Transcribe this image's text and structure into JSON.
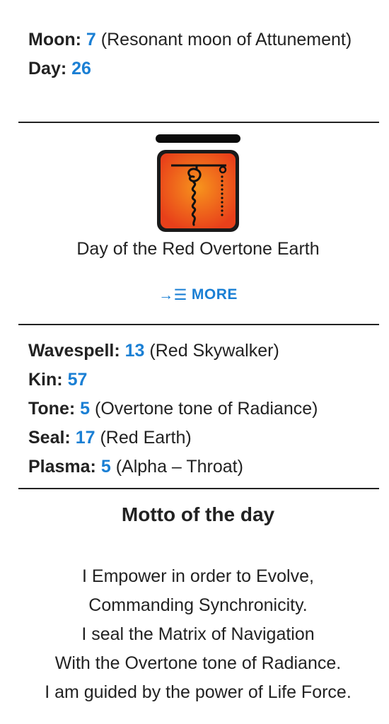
{
  "calendar": {
    "moon_label": "Moon:",
    "moon_value": "7",
    "moon_desc": "(Resonant moon of Attunement)",
    "day_label": "Day:",
    "day_value": "26"
  },
  "glyph": {
    "icon": "red-earth-seal-icon",
    "day_name": "Day of the Red Overtone Earth"
  },
  "more_button": {
    "icon": "arrow-list-icon",
    "icon_glyph": "→☰",
    "label": "MORE"
  },
  "details": {
    "wavespell_label": "Wavespell:",
    "wavespell_value": "13",
    "wavespell_desc": "(Red Skywalker)",
    "kin_label": "Kin:",
    "kin_value": "57",
    "tone_label": "Tone:",
    "tone_value": "5",
    "tone_desc": "(Overtone tone of Radiance)",
    "seal_label": "Seal:",
    "seal_value": "17",
    "seal_desc": "(Red Earth)",
    "plasma_label": "Plasma:",
    "plasma_value": "5",
    "plasma_desc": "(Alpha – Throat)"
  },
  "motto": {
    "title": "Motto of the day",
    "lines": [
      "I Empower in order to Evolve,",
      "Commanding Synchronicity.",
      "I seal the Matrix of Navigation",
      "With the Overtone tone of Radiance.",
      "I am guided by the power of Life Force."
    ]
  },
  "colors": {
    "accent": "#1a7fd4",
    "text": "#222222",
    "seal_red": "#e8401a",
    "seal_orange": "#f7941d"
  }
}
